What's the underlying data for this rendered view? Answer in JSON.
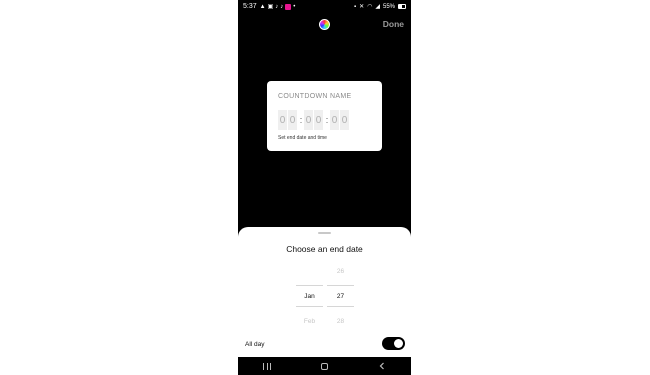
{
  "status_bar": {
    "time": "5:37",
    "left_icons": [
      "alert-icon",
      "gallery-icon",
      "tiktok-icon",
      "tiktok-icon",
      "app-icon"
    ],
    "battery": "55%"
  },
  "top_bar": {
    "done_label": "Done"
  },
  "sticker": {
    "name_placeholder": "COUNTDOWN NAME",
    "digits": [
      "0",
      "0",
      "0",
      "0",
      "0",
      "0"
    ],
    "separator": ":",
    "hint": "Set end date and time"
  },
  "sheet": {
    "title": "Choose an end date",
    "month_column": {
      "above": "",
      "selected": "Jan",
      "below": "Feb"
    },
    "day_column": {
      "above": "26",
      "selected": "27",
      "below": "28"
    },
    "all_day_label": "All day",
    "all_day_on": true
  },
  "colors": {
    "background": "#000000",
    "sheet": "#ffffff",
    "toggle": "#000000"
  }
}
